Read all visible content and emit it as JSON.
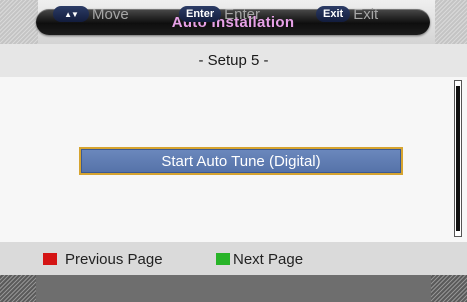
{
  "header": {
    "title": "Auto Installation"
  },
  "subheader": {
    "subtitle": "- Setup 5 -"
  },
  "main": {
    "start_button_label": "Start Auto Tune (Digital)"
  },
  "legend": {
    "previous_label": "Previous Page",
    "previous_color": "#d41414",
    "next_label": "Next Page",
    "next_color": "#28b428"
  },
  "footer": {
    "move_key": "▲▼",
    "move_label": "Move",
    "enter_key": "Enter",
    "enter_label": "Enter",
    "exit_key": "Exit",
    "exit_label": "Exit"
  },
  "colors": {
    "title_text": "#e6a0e6",
    "button_fill": "#5f7cb3",
    "button_border": "#d6a430"
  }
}
